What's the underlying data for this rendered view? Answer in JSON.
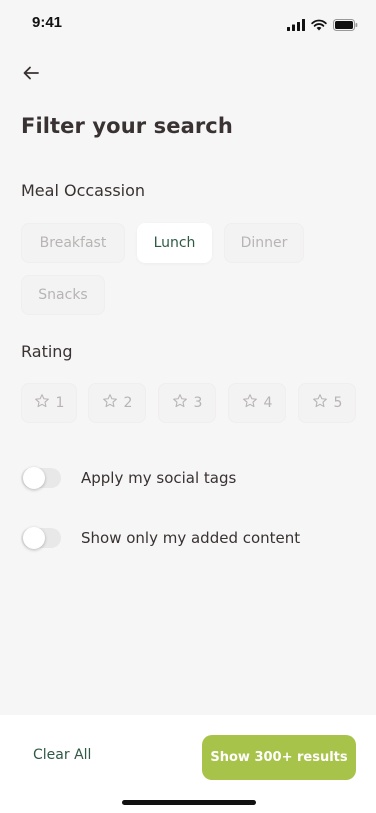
{
  "status_bar": {
    "time": "9:41",
    "icons": [
      "cellular-signal-icon",
      "wifi-icon",
      "battery-icon"
    ]
  },
  "header": {
    "back_icon": "arrow-left-icon",
    "title": "Filter your search"
  },
  "meal_occasion": {
    "label": "Meal Occassion",
    "options": [
      {
        "label": "Breakfast",
        "selected": false
      },
      {
        "label": "Lunch",
        "selected": true
      },
      {
        "label": "Dinner",
        "selected": false
      },
      {
        "label": "Snacks",
        "selected": false
      }
    ]
  },
  "rating": {
    "label": "Rating",
    "options": [
      "1",
      "2",
      "3",
      "4",
      "5"
    ],
    "icon": "star-outline-icon"
  },
  "toggles": [
    {
      "label": "Apply my social tags",
      "on": false
    },
    {
      "label": "Show only my added content",
      "on": false
    }
  ],
  "footer": {
    "clear_label": "Clear All",
    "results_label": "Show 300+ results"
  },
  "colors": {
    "background": "#f6f6f6",
    "accent_green": "#a8c34a",
    "text_dark_green": "#2f5a45",
    "text_primary": "#3a3232",
    "chip_inactive_text": "#b8b4b4"
  }
}
